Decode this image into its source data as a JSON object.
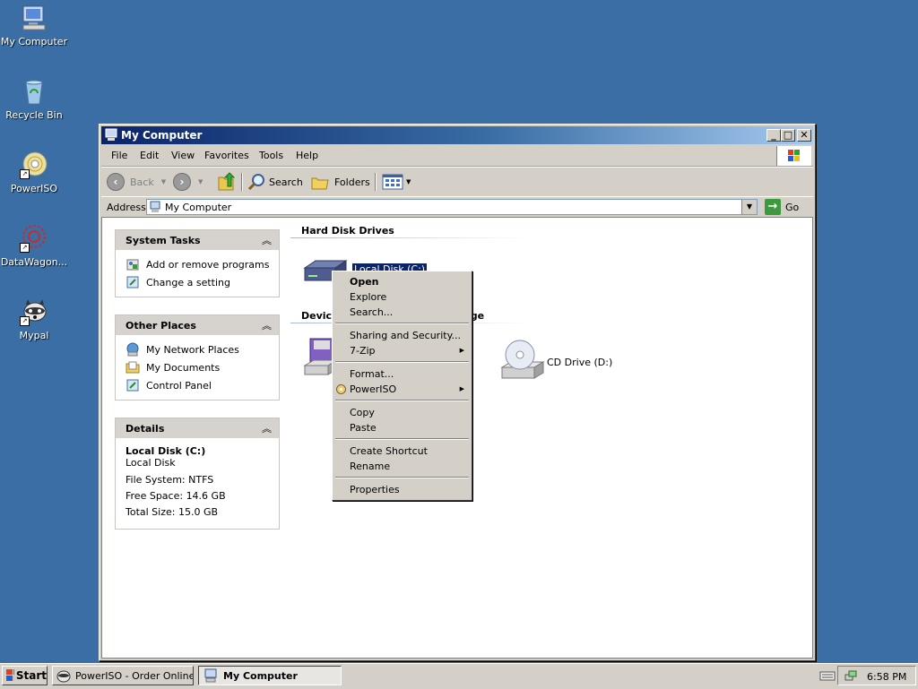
{
  "desktop": {
    "icons": [
      {
        "label": "My Computer"
      },
      {
        "label": "Recycle Bin"
      },
      {
        "label": "PowerISO"
      },
      {
        "label": "DataWagon..."
      },
      {
        "label": "Mypal"
      }
    ]
  },
  "window": {
    "title": "My Computer",
    "menu": [
      "File",
      "Edit",
      "View",
      "Favorites",
      "Tools",
      "Help"
    ],
    "toolbar": {
      "back": "Back",
      "search": "Search",
      "folders": "Folders"
    },
    "address": {
      "label": "Address",
      "value": "My Computer",
      "go": "Go"
    }
  },
  "panes": {
    "system_tasks": {
      "title": "System Tasks",
      "items": [
        "Add or remove programs",
        "Change a setting"
      ]
    },
    "other_places": {
      "title": "Other Places",
      "items": [
        "My Network Places",
        "My Documents",
        "Control Panel"
      ]
    },
    "details": {
      "title": "Details",
      "name": "Local Disk (C:)",
      "type": "Local Disk",
      "file_system": "File System: NTFS",
      "free_space": "Free Space: 14.6 GB",
      "total_size": "Total Size: 15.0 GB"
    }
  },
  "main": {
    "hard_disk_title": "Hard Disk Drives",
    "local_disk": "Local Disk (C:)",
    "devices_title": "Devices with Removable Storage",
    "cd_drive": "CD Drive (D:)"
  },
  "context_menu": {
    "items": [
      "Open",
      "Explore",
      "Search...",
      "Sharing and Security...",
      "7-Zip",
      "Format...",
      "PowerISO",
      "Copy",
      "Paste",
      "Create Shortcut",
      "Rename",
      "Properties"
    ]
  },
  "taskbar": {
    "start": "Start",
    "tasks": [
      "PowerISO - Order Online...",
      "My Computer"
    ],
    "clock": "6:58 PM"
  },
  "colors": {
    "desktop": "#3a6ea5",
    "titlebar": "#0a246a",
    "selection": "#0a246a"
  }
}
